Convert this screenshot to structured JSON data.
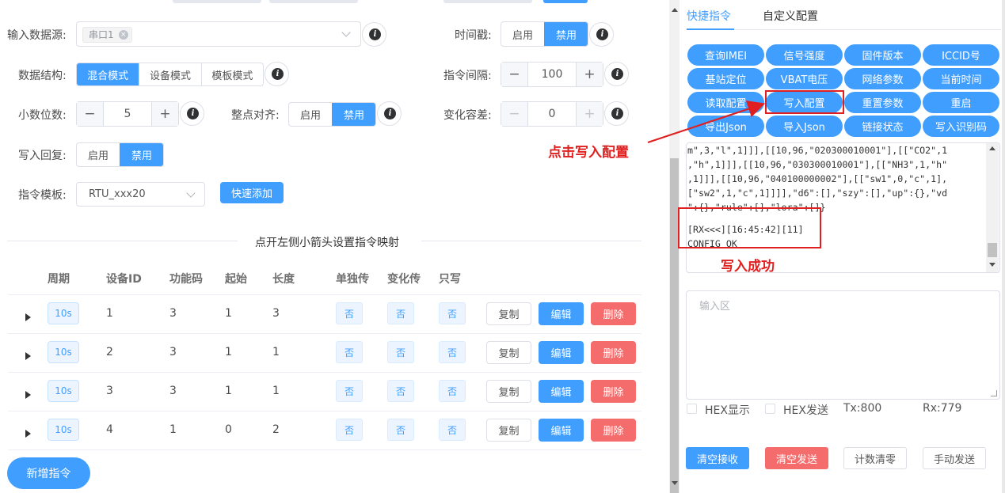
{
  "form": {
    "source_label": "输入数据源:",
    "source_tag": "串口1",
    "timestamp_label": "时间戳:",
    "timestamp_options": [
      "启用",
      "禁用"
    ],
    "structure_label": "数据结构:",
    "structure_options": [
      "混合模式",
      "设备模式",
      "模板模式"
    ],
    "interval_label": "指令间隔:",
    "interval_value": "100",
    "decimal_label": "小数位数:",
    "decimal_value": "5",
    "align_label": "整点对齐:",
    "align_options": [
      "启用",
      "禁用"
    ],
    "tolerance_label": "变化容差:",
    "tolerance_value": "0",
    "writeback_label": "写入回复:",
    "writeback_options": [
      "启用",
      "禁用"
    ],
    "template_label": "指令模板:",
    "template_value": "RTU_xxx20",
    "quick_add": "快速添加",
    "minus": "−",
    "plus": "+",
    "info": "i",
    "tag_close": "×"
  },
  "divider_text": "点开左侧小箭头设置指令映射",
  "table": {
    "headers": [
      "周期",
      "设备ID",
      "功能码",
      "起始",
      "长度",
      "单独传",
      "变化传",
      "只写"
    ],
    "rows": [
      {
        "cycle": "10s",
        "device_id": "1",
        "func": "3",
        "start": "1",
        "length": "3",
        "single": "否",
        "change": "否",
        "writeonly": "否"
      },
      {
        "cycle": "10s",
        "device_id": "2",
        "func": "3",
        "start": "1",
        "length": "1",
        "single": "否",
        "change": "否",
        "writeonly": "否"
      },
      {
        "cycle": "10s",
        "device_id": "3",
        "func": "3",
        "start": "1",
        "length": "1",
        "single": "否",
        "change": "否",
        "writeonly": "否"
      },
      {
        "cycle": "10s",
        "device_id": "4",
        "func": "1",
        "start": "0",
        "length": "2",
        "single": "否",
        "change": "否",
        "writeonly": "否"
      }
    ],
    "copy": "复制",
    "edit": "编辑",
    "delete": "删除"
  },
  "add_command": "新增指令",
  "right": {
    "tabs": [
      "快捷指令",
      "自定义配置"
    ],
    "quick_buttons": [
      "查询IMEI",
      "信号强度",
      "固件版本",
      "ICCID号",
      "基站定位",
      "VBAT电压",
      "网络参数",
      "当前时间",
      "读取配置",
      "写入配置",
      "重置参数",
      "重启",
      "导出Json",
      "导入Json",
      "链接状态",
      "写入识别码"
    ],
    "console_lines": [
      "m\",3,\"l\",1]]],[[10,96,\"020300010001\"],[[\"CO2\",1",
      ",\"h\",1]]],[[10,96,\"030300010001\"],[[\"NH3\",1,\"h\"",
      ",1]]],[[10,96,\"040100000002\"],[[\"sw1\",0,\"c\",1],",
      "[\"sw2\",1,\"c\",1]]]],\"d6\":[],\"szy\":[],\"up\":{},\"vd",
      "\":{},\"rule\":[],\"lora\":[]}",
      "",
      "[RX<<<][16:45:42][11]",
      "CONFIG OK"
    ],
    "input_placeholder": "输入区",
    "hex_display": "HEX显示",
    "hex_send": "HEX发送",
    "tx": "Tx:800",
    "rx": "Rx:779",
    "clear_recv": "清空接收",
    "clear_send": "清空发送",
    "reset_count": "计数清零",
    "manual_send": "手动发送"
  },
  "annotations": {
    "click_write": "点击写入配置",
    "write_success": "写入成功"
  },
  "colors": {
    "primary": "#409eff",
    "danger": "#f56c6c",
    "annotation": "#e02020"
  }
}
